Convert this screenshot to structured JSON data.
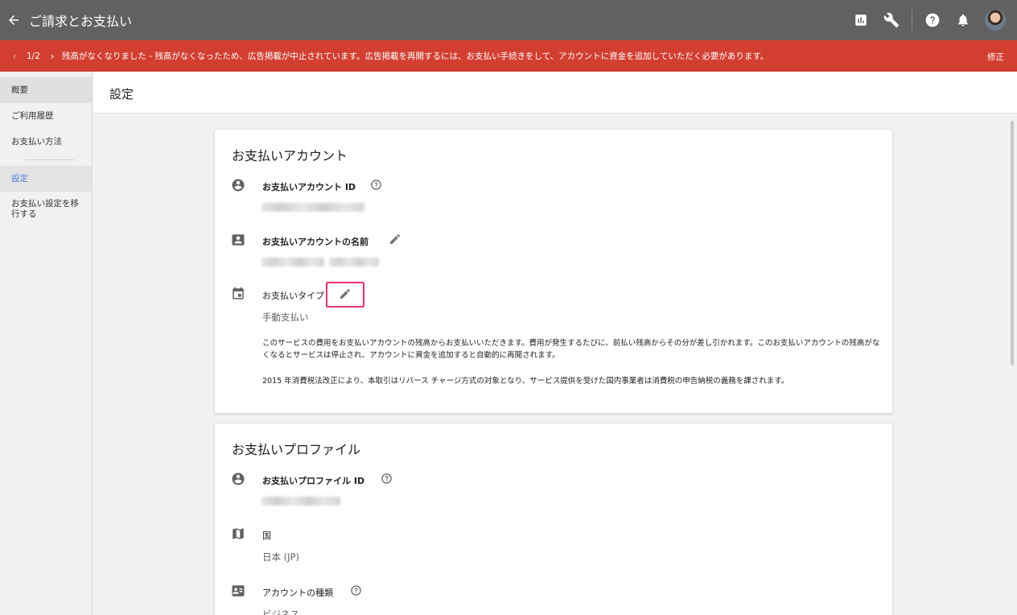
{
  "topbar": {
    "title": "ご請求とお支払い",
    "icons": [
      "back-arrow-icon",
      "reports-icon",
      "tools-wrench-icon",
      "help-icon",
      "notifications-bell-icon",
      "avatar"
    ]
  },
  "alert": {
    "counter": "1/2",
    "message": "残高がなくなりました - 残高がなくなったため、広告掲載が中止されています。広告掲載を再開するには、お支払い手続きをして、アカウントに資金を追加していただく必要があります。",
    "fix_label": "修正",
    "color": "#d23f31"
  },
  "sidebar": {
    "items": [
      {
        "label": "概要"
      },
      {
        "label": "ご利用履歴"
      },
      {
        "label": "お支払い方法"
      },
      {
        "label": "設定"
      },
      {
        "label": "お支払い設定を移行する"
      }
    ],
    "selected_color": "#4a7fd6"
  },
  "main": {
    "title": "設定"
  },
  "account_card": {
    "title": "お支払いアカウント",
    "id_label": "お支払いアカウント ID",
    "name_label": "お支払いアカウントの名前",
    "type_label": "お支払いタイプ",
    "type_value": "手動支払い",
    "description": "このサービスの費用をお支払いアカウントの残高からお支払いいただきます。費用が発生するたびに、前払い残高からその分が差し引かれます。このお支払いアカウントの残高がなくなるとサービスは停止され、アカウントに資金を追加すると自動的に再開されます。",
    "tax_note": "2015 年消費税法改正により、本取引はリバース チャージ方式の対象となり、サービス提供を受けた国内事業者は消費税の申告納税の義務を課されます。",
    "highlight_color": "#e8336f"
  },
  "profile_card": {
    "title": "お支払いプロファイル",
    "id_label": "お支払いプロファイル ID",
    "country_label": "国",
    "country_value": "日本 (JP)",
    "account_type_label": "アカウントの種類",
    "account_type_value": "ビジネス"
  }
}
